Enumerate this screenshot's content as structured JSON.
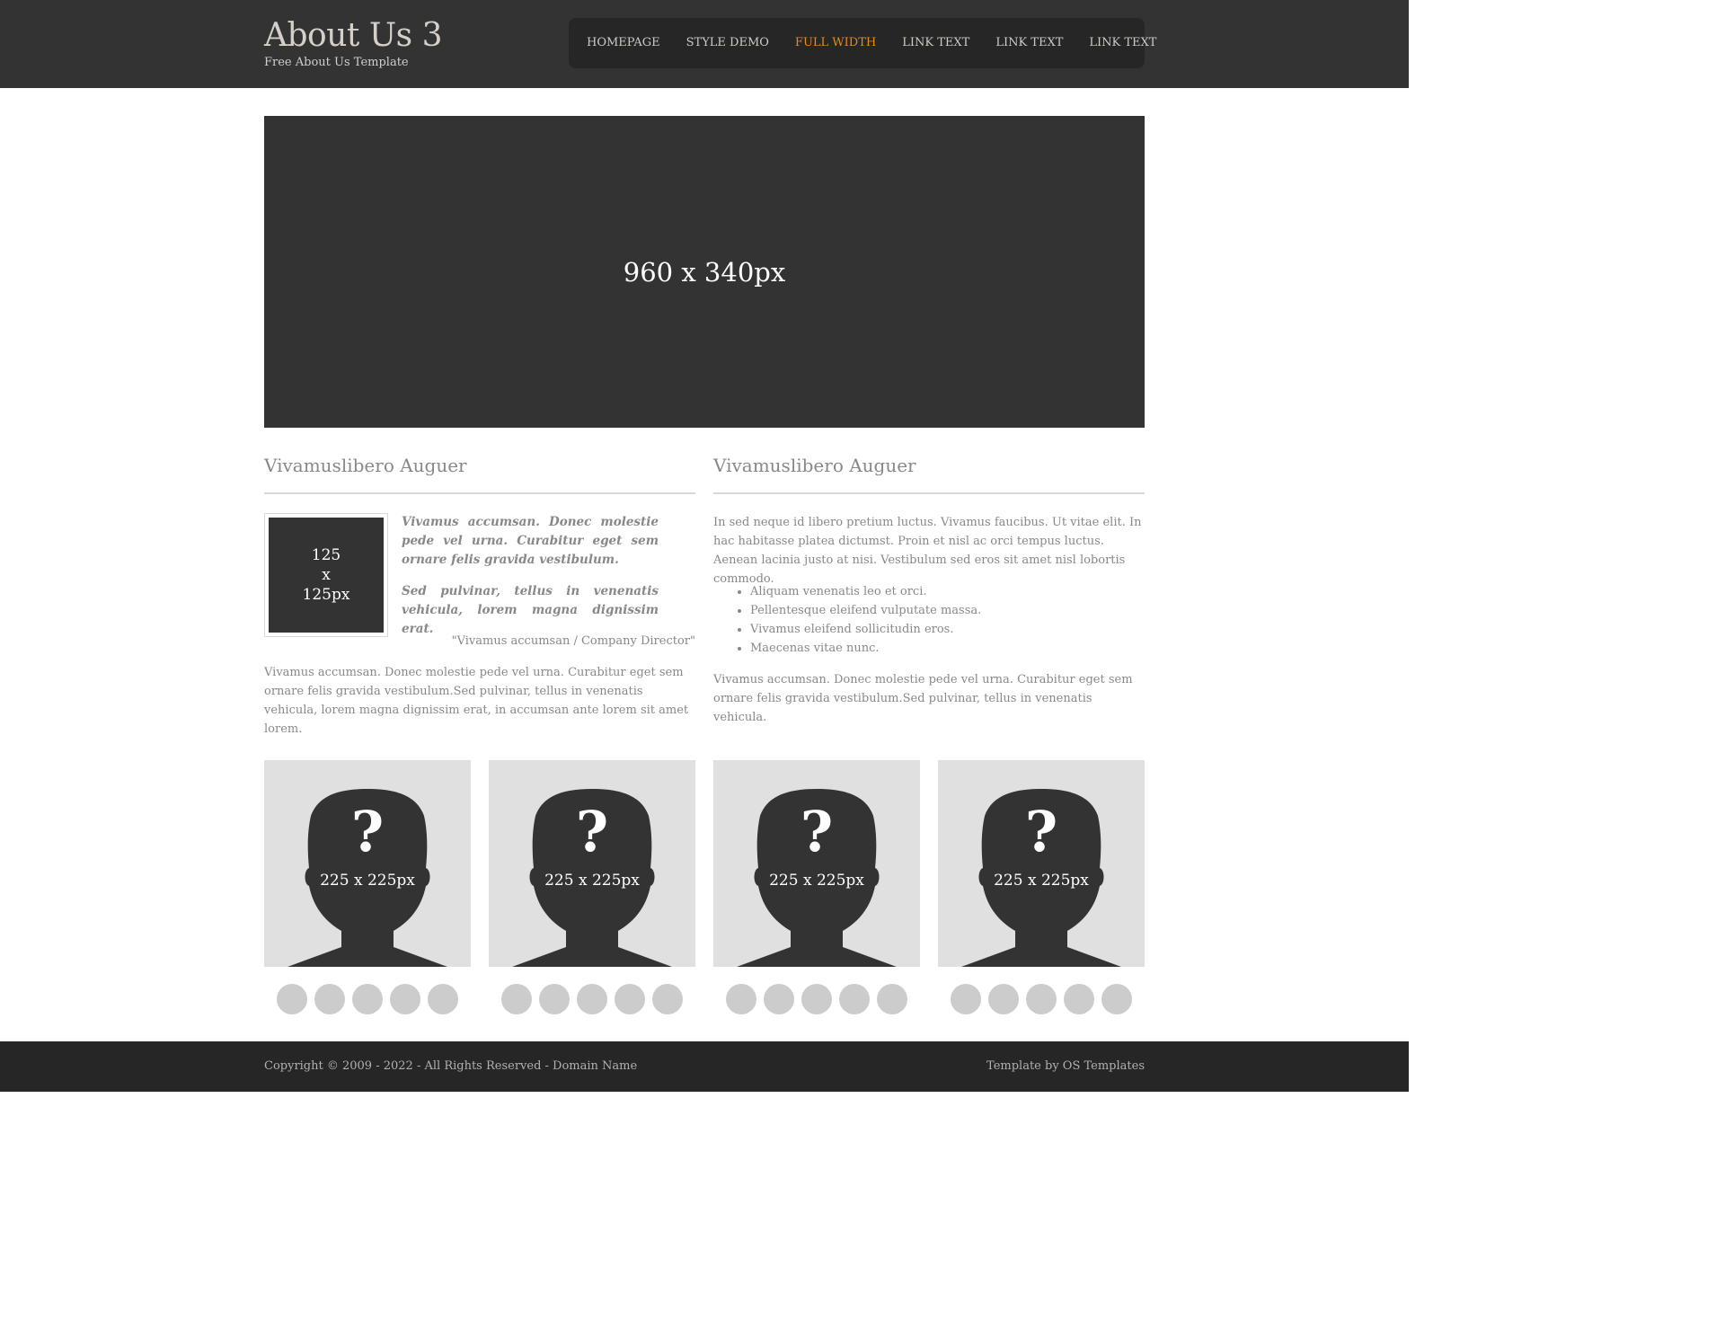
{
  "header": {
    "title": "About Us 3",
    "tagline": "Free About Us Template"
  },
  "nav": {
    "items": [
      {
        "label": "HOMEPAGE"
      },
      {
        "label": "STYLE DEMO"
      },
      {
        "label": "FULL WIDTH"
      },
      {
        "label": "LINK TEXT"
      },
      {
        "label": "LINK TEXT"
      },
      {
        "label": "LINK TEXT"
      }
    ],
    "active_item": "FULL WIDTH",
    "active_color": "#e8891c"
  },
  "hero": {
    "label": "960 x 340px"
  },
  "left_column": {
    "title": "Vivamuslibero Auguer",
    "thumb": {
      "line1": "125",
      "line2": "x",
      "line3": "125px"
    },
    "quote_p1": "Vivamus accumsan. Donec molestie pede vel urna. Curabitur eget sem ornare felis gravida vestibulum.",
    "quote_p2": "Sed pulvinar, tellus in venenatis vehicula, lorem magna dignissim erat.",
    "cite": "\"Vivamus accumsan / Company Director\"",
    "body": "Vivamus accumsan. Donec molestie pede vel urna. Curabitur eget sem ornare felis gravida vestibulum.Sed pulvinar, tellus in venenatis vehicula, lorem magna dignissim erat, in accumsan ante lorem sit amet lorem."
  },
  "right_column": {
    "title": "Vivamuslibero Auguer",
    "p1": "In sed neque id libero pretium luctus. Vivamus faucibus. Ut vitae elit. In hac habitasse platea dictumst. Proin et nisl ac orci tempus luctus. Aenean lacinia justo at nisi. Vestibulum sed eros sit amet nisl lobortis commodo.",
    "list": [
      "Aliquam venenatis leo et orci.",
      "Pellentesque eleifend vulputate massa.",
      "Vivamus eleifend sollicitudin eros.",
      "Maecenas vitae nunc."
    ],
    "p2": "Vivamus accumsan. Donec molestie pede vel urna. Curabitur eget sem ornare felis gravida vestibulum.Sed pulvinar, tellus in venenatis vehicula."
  },
  "team": {
    "members": [
      {
        "photo_label": "225 x 225px",
        "mark": "?"
      },
      {
        "photo_label": "225 x 225px",
        "mark": "?"
      },
      {
        "photo_label": "225 x 225px",
        "mark": "?"
      },
      {
        "photo_label": "225 x 225px",
        "mark": "?"
      }
    ]
  },
  "footer": {
    "copyright": "Copyright © 2009 - 2022 - All Rights Reserved - Domain Name",
    "credit": "Template by OS Templates"
  }
}
